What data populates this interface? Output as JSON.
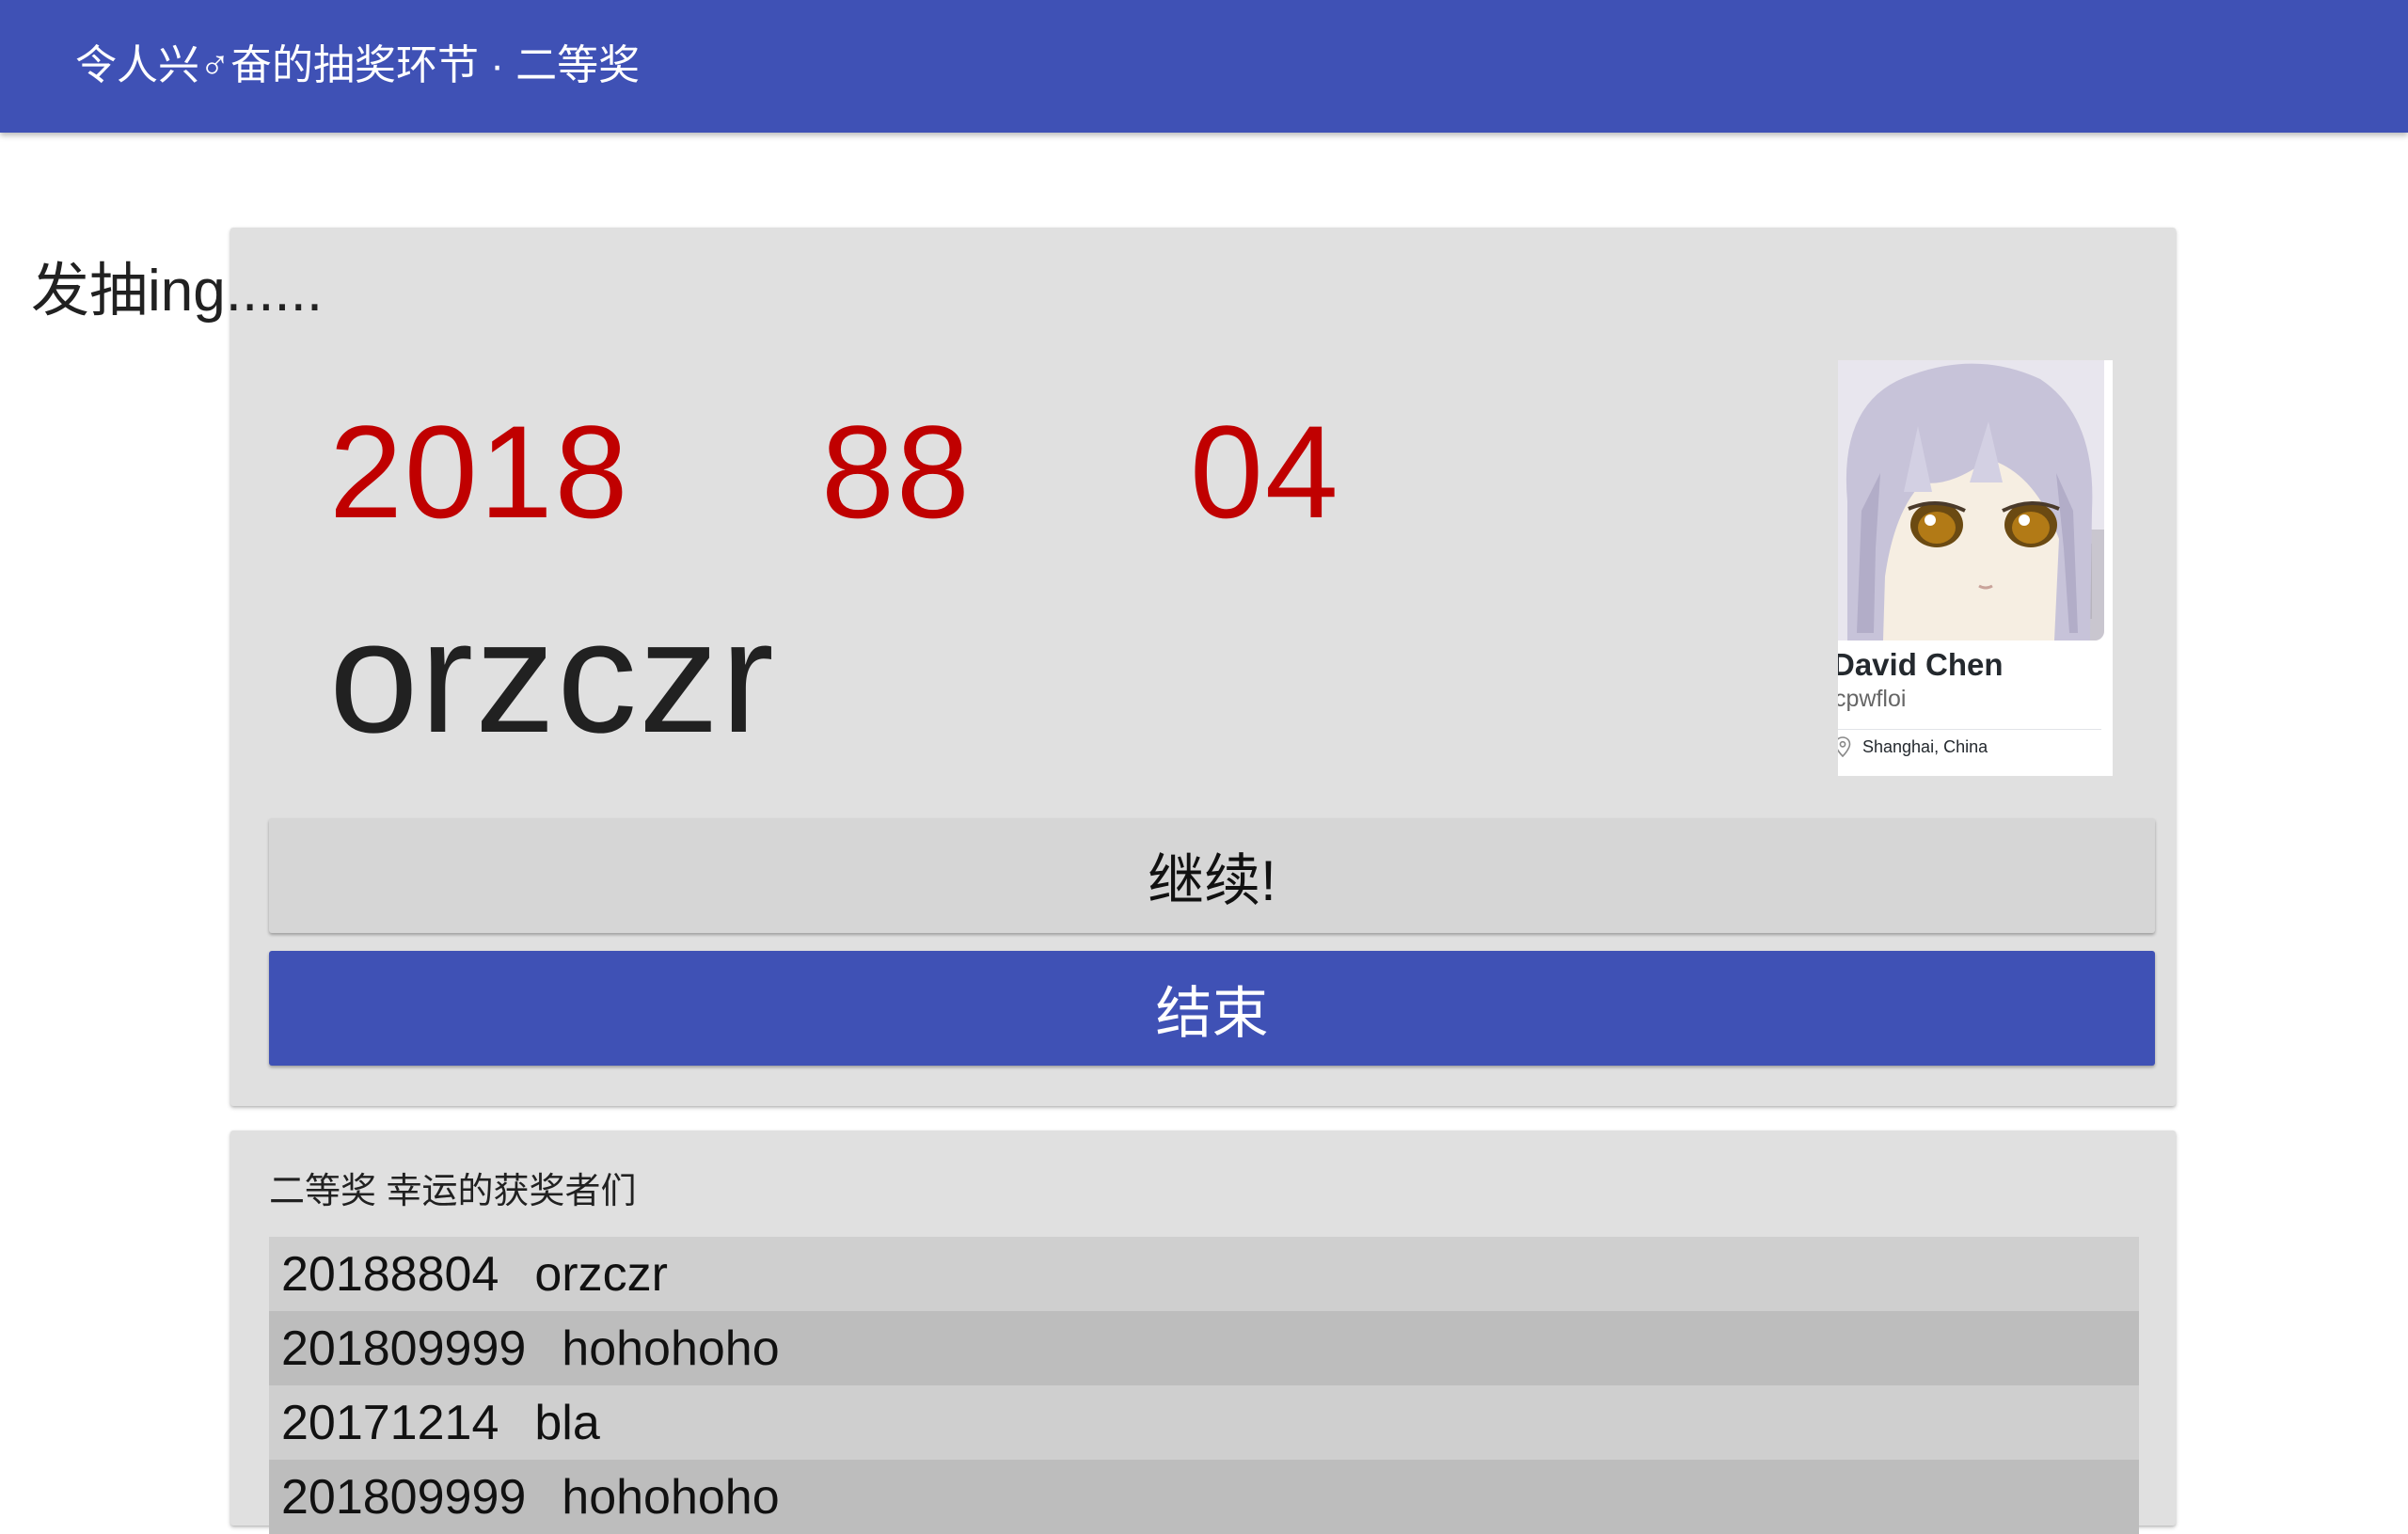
{
  "header": {
    "title": "令人兴♂奋的抽奖环节 · 二等奖",
    "color": "#3f51b5"
  },
  "draw": {
    "status": "发抽ing......",
    "digits": [
      "2018",
      "88",
      "04"
    ],
    "name": "orzczr",
    "digit_color": "#c00000"
  },
  "profile_card": {
    "display_name": "David Chen",
    "login": "cpwfloi",
    "location": "Shanghai, China"
  },
  "buttons": {
    "continue_label": "继续!",
    "end_label": "结束"
  },
  "winners": {
    "title": "二等奖 幸运的获奖者们",
    "rows": [
      {
        "id": "20188804",
        "name": "orzczr"
      },
      {
        "id": "201809999",
        "name": "hohohoho"
      },
      {
        "id": "20171214",
        "name": "bla"
      },
      {
        "id": "201809999",
        "name": "hohohoho"
      }
    ],
    "row_colors": [
      "#cfcfcf",
      "#bdbdbd"
    ]
  }
}
